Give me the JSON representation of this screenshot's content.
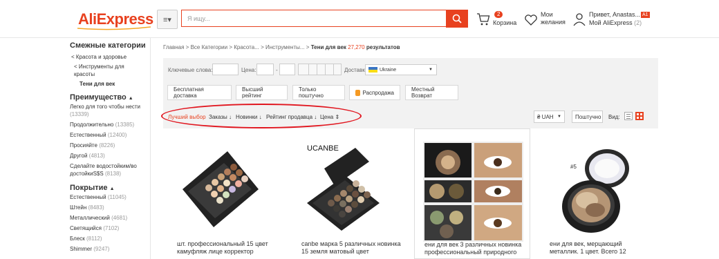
{
  "header": {
    "logo": "AliExpress",
    "categories_icon": "menu-icon",
    "search_placeholder": "Я ищу...",
    "cart": {
      "count": "2",
      "label": "Корзина"
    },
    "wishlist": {
      "label": "Мои желания"
    },
    "account": {
      "greeting": "Привет, Anastas...",
      "badge": "A1",
      "my": "Мой AliExpress",
      "my_count": "(2)"
    },
    "accent": "#e8411f"
  },
  "sidebar": {
    "related_title": "Смежные категории",
    "related": [
      "< Красота и здоровье",
      "< Инструменты для красоты",
      "Тени для век"
    ],
    "advantage_title": "Преимущество",
    "advantages": [
      {
        "label": "Легко для того чтобы нести",
        "count": "(13339)"
      },
      {
        "label": "Продолжительно",
        "count": "(13385)"
      },
      {
        "label": "Естественный",
        "count": "(12400)"
      },
      {
        "label": "Просияйте",
        "count": "(8226)"
      },
      {
        "label": "Другой",
        "count": "(4813)"
      },
      {
        "label": "Сделайте водостойким/водостойкиS$S",
        "count": "(8138)"
      }
    ],
    "coverage_title": "Покрытие",
    "coverage": [
      {
        "label": "Естественный",
        "count": "(11045)"
      },
      {
        "label": "Штейн",
        "count": "(8483)"
      },
      {
        "label": "Металлический",
        "count": "(4681)"
      },
      {
        "label": "Светящийся",
        "count": "(7102)"
      },
      {
        "label": "Блеск",
        "count": "(8112)"
      },
      {
        "label": "Shimmer",
        "count": "(9247)"
      }
    ]
  },
  "breadcrumb": {
    "items": [
      "Главная",
      "Все Категории",
      "Красота...",
      "Инструменты..."
    ],
    "current": "Тени для век",
    "count": "27,270",
    "suffix": "результатов"
  },
  "filters": {
    "keywords_label": "Ключевые слова:",
    "price_label": "Цена:",
    "price_sep": "-",
    "ship_label": "Доставка в",
    "ship_value": "Ukraine",
    "tags": [
      "Бесплатная доставка",
      "Высший рейтинг",
      "Только поштучно",
      "Распродажа",
      "Местный Возврат"
    ]
  },
  "sort": {
    "best": "Лучший выбор",
    "orders": "Заказы",
    "new": "Новинки",
    "seller": "Рейтинг продавца",
    "price": "Цена",
    "currency": "₴ UAH",
    "unit": "Поштучно",
    "view_label": "Вид:"
  },
  "products": [
    {
      "title": "шт. профессиональный 15 цвет камуфляж лице корректор"
    },
    {
      "title": "canbe марка 5 различных новинка 15 земля матовый цвет",
      "brand": "UCANBE"
    },
    {
      "title": "ени для век 3 различных новинка профессиональный природного"
    },
    {
      "title": "ени для век, мерцающий металлик. 1 цвет. Всего 12",
      "badge": "#5"
    }
  ]
}
